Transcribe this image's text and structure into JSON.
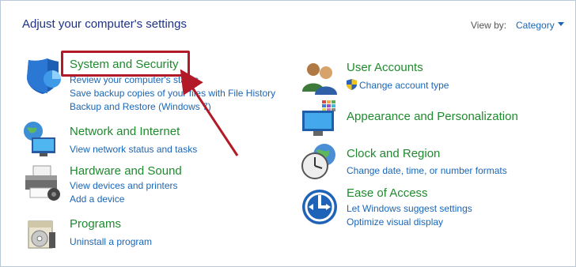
{
  "header": {
    "title": "Adjust your computer's settings",
    "view_by_label": "View by:",
    "view_by_value": "Category"
  },
  "categories_left": [
    {
      "title": "System and Security",
      "icon": "shield-icon",
      "links": [
        "Review your computer's status",
        "Save backup copies of your files with File History",
        "Backup and Restore (Windows 7)"
      ]
    },
    {
      "title": "Network and Internet",
      "icon": "network-icon",
      "links": [
        "View network status and tasks"
      ]
    },
    {
      "title": "Hardware and Sound",
      "icon": "printer-icon",
      "links": [
        "View devices and printers",
        "Add a device"
      ]
    },
    {
      "title": "Programs",
      "icon": "programs-icon",
      "links": [
        "Uninstall a program"
      ]
    }
  ],
  "categories_right": [
    {
      "title": "User Accounts",
      "icon": "users-icon",
      "links": [
        "Change account type"
      ]
    },
    {
      "title": "Appearance and Personalization",
      "icon": "monitor-icon",
      "links": []
    },
    {
      "title": "Clock and Region",
      "icon": "clock-icon",
      "links": [
        "Change date, time, or number formats"
      ]
    },
    {
      "title": "Ease of Access",
      "icon": "ease-of-access-icon",
      "links": [
        "Let Windows suggest settings",
        "Optimize visual display"
      ]
    }
  ],
  "colors": {
    "title_blue": "#1e3287",
    "category_green": "#1f8a2e",
    "link_blue": "#1a66b8",
    "highlight_red": "#b11a26"
  }
}
